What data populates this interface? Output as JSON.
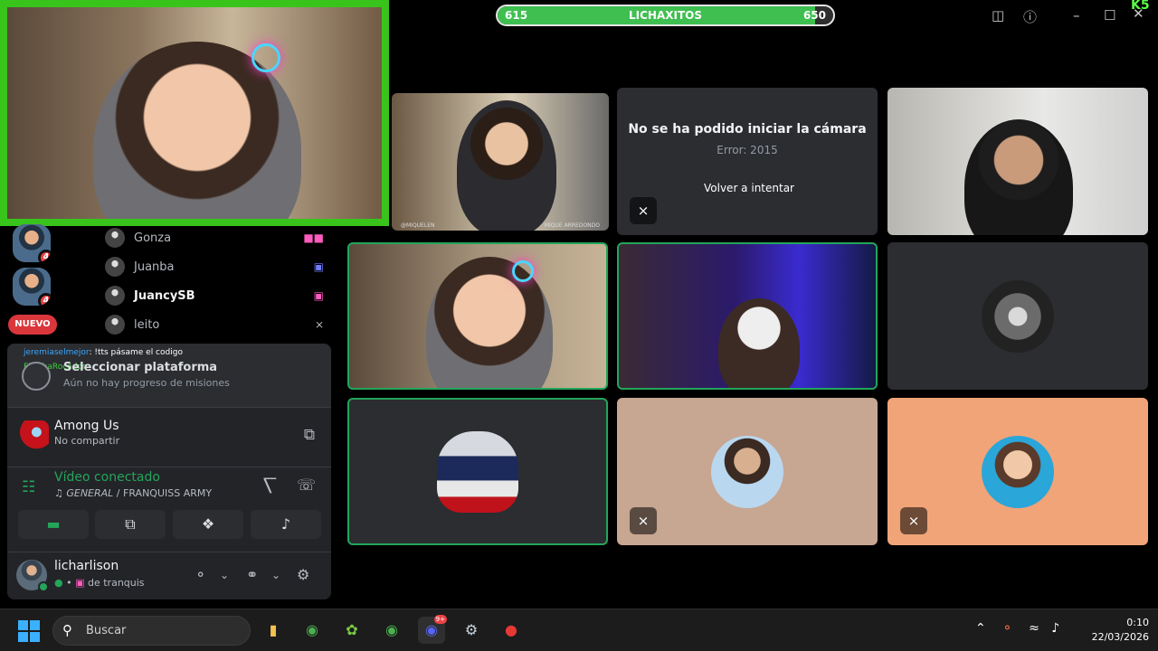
{
  "stream_goal": {
    "title": "LICHAXITOS",
    "current": "615",
    "target": "650",
    "progress_fraction": 0.946,
    "fill_color": "#3fbf50"
  },
  "window": {
    "badge": "K5",
    "minimize": "–",
    "maximize": "☐",
    "close": "✕"
  },
  "server_badges": [
    "4",
    "4"
  ],
  "new_label": "NUEVO",
  "members": [
    {
      "name": "Gonza",
      "bold": false,
      "icon": "camera-and-stream-icon"
    },
    {
      "name": "Juanba",
      "bold": false,
      "icon": "stream-icon"
    },
    {
      "name": "JuancySB",
      "bold": true,
      "icon": "stream-icon"
    },
    {
      "name": "leito",
      "bold": false,
      "icon": "muted-mic-icon"
    }
  ],
  "chat": {
    "user": "jeremiaselmejor",
    "message": ": !tts pásame el codigo",
    "overlay_user": "ElLichaRocador"
  },
  "quest": {
    "title": "Seleccionar plataforma",
    "subtitle": "Aún no hay progreso de misiones"
  },
  "activity": {
    "game": "Among Us",
    "status": "No compartir"
  },
  "voice": {
    "status": "Vídeo conectado",
    "channel": "GENERAL",
    "separator": " / ",
    "server": "FRANQUISS ARMY",
    "status_color": "#23a55a"
  },
  "user": {
    "name": "licharlison",
    "status": "de tranquis"
  },
  "camera_error": {
    "title": "No se ha podido iniciar la cámara",
    "code": "Error: 2015",
    "retry": "Volver a intentar"
  },
  "tile_overlay_texts": {
    "tile1_left": "@MIQUELEN",
    "tile1_right": "MIQUE ARREDONDO"
  },
  "taskbar": {
    "search_placeholder": "Buscar",
    "discord_badge": "9+",
    "time": "0:10",
    "date": "22/03/2026"
  }
}
